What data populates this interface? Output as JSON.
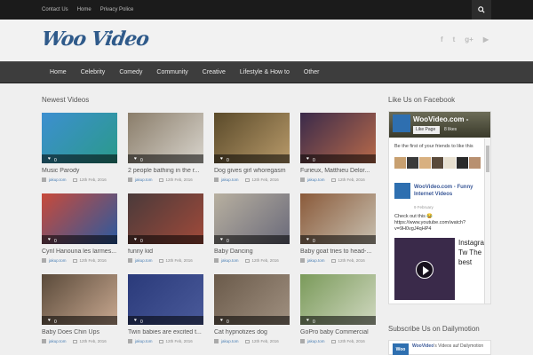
{
  "topbar": {
    "links": [
      "Contact Us",
      "Home",
      "Privacy Police"
    ],
    "search_icon": "search-icon"
  },
  "header": {
    "logo_text": "Woo Video",
    "social_icons": [
      "facebook-icon",
      "twitter-icon",
      "google-plus-icon",
      "youtube-icon"
    ],
    "social_glyphs": [
      "f",
      "t",
      "g+",
      "▶"
    ]
  },
  "nav": {
    "items": [
      "Home",
      "Celebrity",
      "Comedy",
      "Community",
      "Creative",
      "Lifestyle & How to",
      "Other"
    ]
  },
  "main": {
    "section_title": "Newest Videos",
    "videos": [
      {
        "title": "Music Parody",
        "user": "jakup.tom",
        "date": "12th Feb, 2016",
        "likes": "0",
        "colors": [
          "#3d8fd0",
          "#2a9a8a"
        ]
      },
      {
        "title": "2 people bathing in the r...",
        "user": "jakup.tom",
        "date": "12th Feb, 2016",
        "likes": "0",
        "colors": [
          "#8a7d6a",
          "#d8d4cc"
        ]
      },
      {
        "title": "Dog gives girl whoregasm",
        "user": "jakup.tom",
        "date": "12th Feb, 2016",
        "likes": "0",
        "colors": [
          "#5a4a2a",
          "#b89a6a"
        ]
      },
      {
        "title": "Furieux, Matthieu Delor...",
        "user": "jakup.tom",
        "date": "12th Feb, 2016",
        "likes": "0",
        "colors": [
          "#3a2a4a",
          "#b86a4a"
        ]
      },
      {
        "title": "Cyril Hanouna les larmes...",
        "user": "jakup.tom",
        "date": "12th Feb, 2016",
        "likes": "0",
        "colors": [
          "#c84a3a",
          "#2a5aa0"
        ]
      },
      {
        "title": "funny kid",
        "user": "jakup.tom",
        "date": "12th Feb, 2016",
        "likes": "0",
        "colors": [
          "#4a3a3a",
          "#a04a3a"
        ]
      },
      {
        "title": "Baby Dancing",
        "user": "jakup.tom",
        "date": "12th Feb, 2016",
        "likes": "0",
        "colors": [
          "#b8b0a0",
          "#6a6a7a"
        ]
      },
      {
        "title": "Baby goat tries to head-...",
        "user": "jakup.tom",
        "date": "12th Feb, 2016",
        "likes": "0",
        "colors": [
          "#8a5a3a",
          "#c8c0b0"
        ]
      },
      {
        "title": "Baby Does Chin Ups",
        "user": "jakup.tom",
        "date": "12th Feb, 2016",
        "likes": "0",
        "colors": [
          "#5a4a3a",
          "#c8a890"
        ]
      },
      {
        "title": "Twin babies are excited t...",
        "user": "jakup.tom",
        "date": "12th Feb, 2016",
        "likes": "0",
        "colors": [
          "#2a3a7a",
          "#4a5a9a"
        ]
      },
      {
        "title": "Cat hypnotizes dog",
        "user": "jakup.tom",
        "date": "12th Feb, 2016",
        "likes": "0",
        "colors": [
          "#6a5a4a",
          "#a09080"
        ]
      },
      {
        "title": "GoPro baby Commercial",
        "user": "jakup.tom",
        "date": "12th Feb, 2016",
        "likes": "0",
        "colors": [
          "#7a9a5a",
          "#d0d8c0"
        ]
      }
    ]
  },
  "sidebar": {
    "fb_title": "Like Us on Facebook",
    "fb_page_name": "WooVideo.com -",
    "fb_like_button": "Like Page",
    "fb_likes": "8 likes",
    "fb_friends_text": "Be the first of your friends to like this",
    "fb_post_name": "WooVideo.com - Funny Internet Videos",
    "fb_post_date": "9 February",
    "fb_post_text": "Check out this 😂 https://www.youtube.com/watch?v=9H0vgJ4qHP4",
    "fb_post_side": "Instagram Tw The best",
    "dm_title": "Subscribe Us on Dailymotion",
    "dm_logo": "Woo",
    "dm_name": "WooVideo",
    "dm_text": "'s Videos auf Dailymotion"
  }
}
